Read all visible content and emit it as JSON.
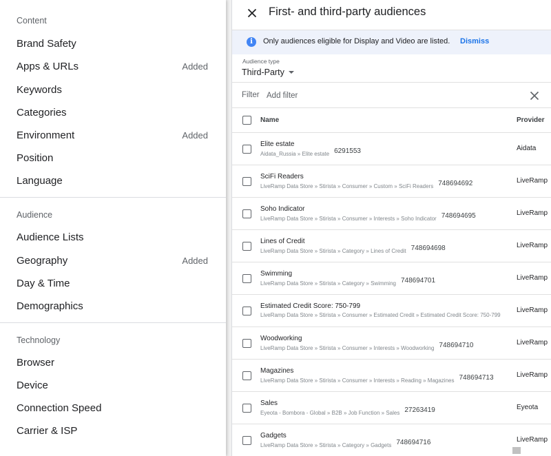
{
  "menu": {
    "sections": [
      {
        "title": "Content",
        "items": [
          {
            "label": "Brand Safety",
            "badge": ""
          },
          {
            "label": "Apps & URLs",
            "badge": "Added"
          },
          {
            "label": "Keywords",
            "badge": ""
          },
          {
            "label": "Categories",
            "badge": ""
          },
          {
            "label": "Environment",
            "badge": "Added"
          },
          {
            "label": "Position",
            "badge": ""
          },
          {
            "label": "Language",
            "badge": ""
          }
        ]
      },
      {
        "title": "Audience",
        "items": [
          {
            "label": "Audience Lists",
            "badge": ""
          },
          {
            "label": "Geography",
            "badge": "Added"
          },
          {
            "label": "Day & Time",
            "badge": ""
          },
          {
            "label": "Demographics",
            "badge": ""
          }
        ]
      },
      {
        "title": "Technology",
        "items": [
          {
            "label": "Browser",
            "badge": ""
          },
          {
            "label": "Device",
            "badge": ""
          },
          {
            "label": "Connection Speed",
            "badge": ""
          },
          {
            "label": "Carrier & ISP",
            "badge": ""
          }
        ]
      }
    ]
  },
  "panel": {
    "title": "First- and third-party audiences",
    "banner": {
      "text": "Only audiences eligible for Display and Video are listed.",
      "dismiss": "Dismiss"
    },
    "audience_type": {
      "label": "Audience type",
      "value": "Third-Party"
    },
    "filter": {
      "label": "Filter",
      "placeholder": "Add filter"
    },
    "columns": {
      "name": "Name",
      "provider": "Provider"
    },
    "rows": [
      {
        "name": "Elite estate",
        "path": "Aidata_Russia » Elite estate",
        "id": "6291553",
        "provider": "Aidata"
      },
      {
        "name": "SciFi Readers",
        "path": "LiveRamp Data Store » Stirista » Consumer » Custom » SciFi Readers",
        "id": "748694692",
        "provider": "LiveRamp"
      },
      {
        "name": "Soho Indicator",
        "path": "LiveRamp Data Store » Stirista » Consumer » Interests » Soho Indicator",
        "id": "748694695",
        "provider": "LiveRamp"
      },
      {
        "name": "Lines of Credit",
        "path": "LiveRamp Data Store » Stirista » Category » Lines of Credit",
        "id": "748694698",
        "provider": "LiveRamp"
      },
      {
        "name": "Swimming",
        "path": "LiveRamp Data Store » Stirista » Category » Swimming",
        "id": "748694701",
        "provider": "LiveRamp"
      },
      {
        "name": "Estimated Credit Score: 750-799",
        "path": "LiveRamp Data Store » Stirista » Consumer » Estimated Credit » Estimated Credit Score: 750-799",
        "id": "",
        "provider": "LiveRamp"
      },
      {
        "name": "Woodworking",
        "path": "LiveRamp Data Store » Stirista » Consumer » Interests » Woodworking",
        "id": "748694710",
        "provider": "LiveRamp"
      },
      {
        "name": "Magazines",
        "path": "LiveRamp Data Store » Stirista » Consumer » Interests » Reading » Magazines",
        "id": "748694713",
        "provider": "LiveRamp"
      },
      {
        "name": "Sales",
        "path": "Eyeota - Bombora - Global » B2B » Job Function » Sales",
        "id": "27263419",
        "provider": "Eyeota"
      },
      {
        "name": "Gadgets",
        "path": "LiveRamp Data Store » Stirista » Category » Gadgets",
        "id": "748694716",
        "provider": "LiveRamp"
      }
    ]
  },
  "icons": {
    "close": "close-icon",
    "info": "info-icon",
    "clear": "clear-filter-icon",
    "caret": "caret-down-icon"
  },
  "colors": {
    "accent": "#1a73e8",
    "info_bg": "#eef2fb",
    "info_icon": "#4285f4"
  }
}
